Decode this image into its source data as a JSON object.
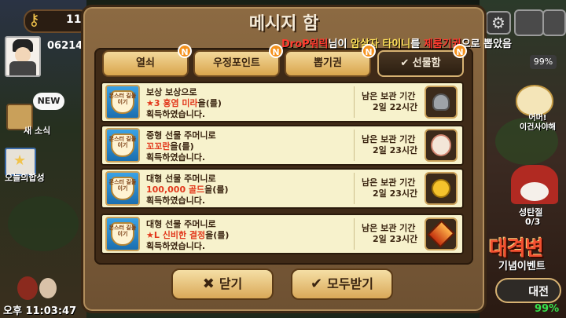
{
  "hud": {
    "top_number": "11",
    "player_number": "06214",
    "new_badge": "NEW",
    "news_label": "새 소식",
    "attendance_label": "오늘의합성",
    "time": "오후 11:03:47",
    "battery": "99%",
    "egg_label_line1": "어머!",
    "egg_label_line2": "이건사야해",
    "santa_label": "성탄절",
    "santa_count": "0/3",
    "event_title": "대격변",
    "event_subtitle": "기념이벤트",
    "battle_button": "대전",
    "percent": "99%"
  },
  "dialog": {
    "title": "메시지 함",
    "ticker": {
      "name": "DroP워릭",
      "mid1": "님이 ",
      "target": "암살자 타이니",
      "mid2": "를 ",
      "method": "제룸기권",
      "end": "으로 뽑았음"
    },
    "tabs": [
      {
        "label": "열쇠",
        "badge": "N",
        "active": false
      },
      {
        "label": "우정포인트",
        "badge": "N",
        "active": false
      },
      {
        "label": "뽑기권",
        "badge": "N",
        "active": false
      },
      {
        "label": "✔ 선물함",
        "badge": "N",
        "active": true
      }
    ],
    "items": [
      {
        "logo_text": "몬스터 길들이기",
        "line1": "보상 보상으로",
        "line2_highlight": "★3 홍염 미라",
        "line2_rest": "을(를)",
        "line3": "획득하였습니다.",
        "remain_label": "남은 보관 기간",
        "remain_value": "2일 22시간",
        "gift_icon": "helmet-icon"
      },
      {
        "logo_text": "몬스터 길들이기",
        "line1": "중형 선물 주머니로",
        "line2_highlight": "꼬꼬란",
        "line2_rest": "을(를)",
        "line3": "획득하였습니다.",
        "remain_label": "남은 보관 기간",
        "remain_value": "2일 23시간",
        "gift_icon": "doll-icon"
      },
      {
        "logo_text": "몬스터 길들이기",
        "line1": "대형 선물 주머니로",
        "line2_highlight": "100,000 골드",
        "line2_rest": "을(를)",
        "line3": "획득하였습니다.",
        "remain_label": "남은 보관 기간",
        "remain_value": "2일 23시간",
        "gift_icon": "gold-coin-icon"
      },
      {
        "logo_text": "몬스터 길들이기",
        "line1": "대형 선물 주머니로",
        "line2_highlight": "★L 신비한 결정",
        "line2_rest": "을(를)",
        "line3": "획득하였습니다.",
        "remain_label": "남은 보관 기간",
        "remain_value": "2일 23시간",
        "gift_icon": "crystal-icon"
      }
    ],
    "buttons": {
      "close": "닫기",
      "receive_all": "모두받기"
    }
  },
  "colors": {
    "highlight_red": "#e2381c",
    "panel_brown": "#6e5132",
    "item_bg": "#f7f2cc",
    "badge_orange": "#f5921e"
  }
}
